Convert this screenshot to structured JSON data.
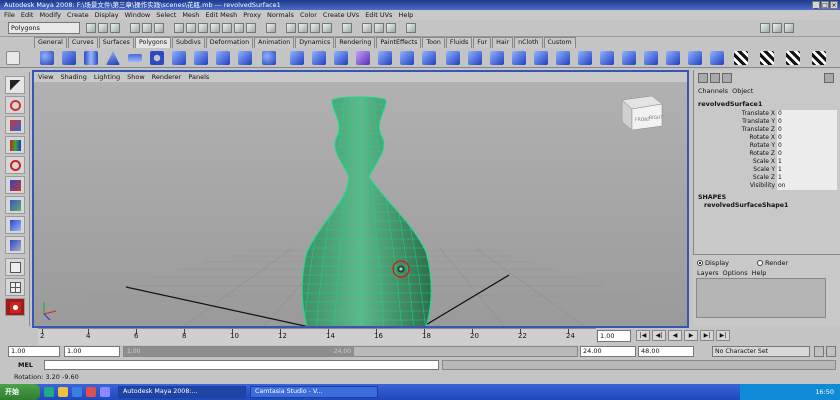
{
  "window": {
    "title": "Autodesk Maya 2008:  F:\\场景文件\\第三章\\操作实践\\scenes\\花瓶.mb   ---   revolvedSurface1",
    "buttons": [
      "_",
      "□",
      "×"
    ]
  },
  "menubar": [
    "File",
    "Edit",
    "Modify",
    "Create",
    "Display",
    "Window",
    "Select",
    "Mesh",
    "Edit Mesh",
    "Proxy",
    "Normals",
    "Color",
    "Create UVs",
    "Edit UVs",
    "Help"
  ],
  "statusline": {
    "mode": "Polygons"
  },
  "shelf": {
    "tabs": [
      "General",
      "Curves",
      "Surfaces",
      "Polygons",
      "Subdivs",
      "Deformation",
      "Animation",
      "Dynamics",
      "Rendering",
      "PaintEffects",
      "Toon",
      "Fluids",
      "Fur",
      "Hair",
      "nCloth",
      "Custom"
    ],
    "active_tab": "Polygons"
  },
  "viewport": {
    "menu": [
      "View",
      "Shading",
      "Lighting",
      "Show",
      "Renderer",
      "Panels"
    ],
    "viewcube": {
      "front": "FRONT",
      "right": "RIGHT"
    }
  },
  "channelbox": {
    "menu": [
      "Channels",
      "Object"
    ],
    "object_name": "revolvedSurface1",
    "attributes": [
      {
        "name": "Translate X",
        "value": "0"
      },
      {
        "name": "Translate Y",
        "value": "0"
      },
      {
        "name": "Translate Z",
        "value": "0"
      },
      {
        "name": "Rotate X",
        "value": "0"
      },
      {
        "name": "Rotate Y",
        "value": "0"
      },
      {
        "name": "Rotate Z",
        "value": "0"
      },
      {
        "name": "Scale X",
        "value": "1"
      },
      {
        "name": "Scale Y",
        "value": "1"
      },
      {
        "name": "Scale Z",
        "value": "1"
      },
      {
        "name": "Visibility",
        "value": "on"
      }
    ],
    "shapes_header": "SHAPES",
    "shape_name": "revolvedSurfaceShape1"
  },
  "layer_editor": {
    "display_label": "Display",
    "render_label": "Render",
    "menu": [
      "Layers",
      "Options",
      "Help"
    ]
  },
  "timeline": {
    "labels": [
      "2",
      "4",
      "6",
      "8",
      "10",
      "12",
      "14",
      "16",
      "18",
      "20",
      "22",
      "24"
    ],
    "current_frame": "1.00",
    "playback_buttons": [
      "|◀",
      "◀|",
      "◀",
      "▶",
      "▶|",
      "▶|"
    ]
  },
  "range": {
    "start": "1.00",
    "playback_start": "1.00",
    "slider_start": "1.00",
    "slider_end": "24.00",
    "playback_end": "24.00",
    "end": "48.00",
    "character_set": "No Character Set"
  },
  "command_line": {
    "label": "MEL"
  },
  "help_line": {
    "text": "Rotation:  3.20    -9.60"
  },
  "taskbar": {
    "start_label": "开始",
    "tasks": [
      "Autodesk Maya 2008:...",
      "Camtasia Studio - V..."
    ],
    "clock": "16:50"
  },
  "colors": {
    "title_bar": "#1d3a8c",
    "viewport_border": "#3556b8",
    "wireframe": "#19d48a",
    "taskbar": "#2a56c8"
  }
}
